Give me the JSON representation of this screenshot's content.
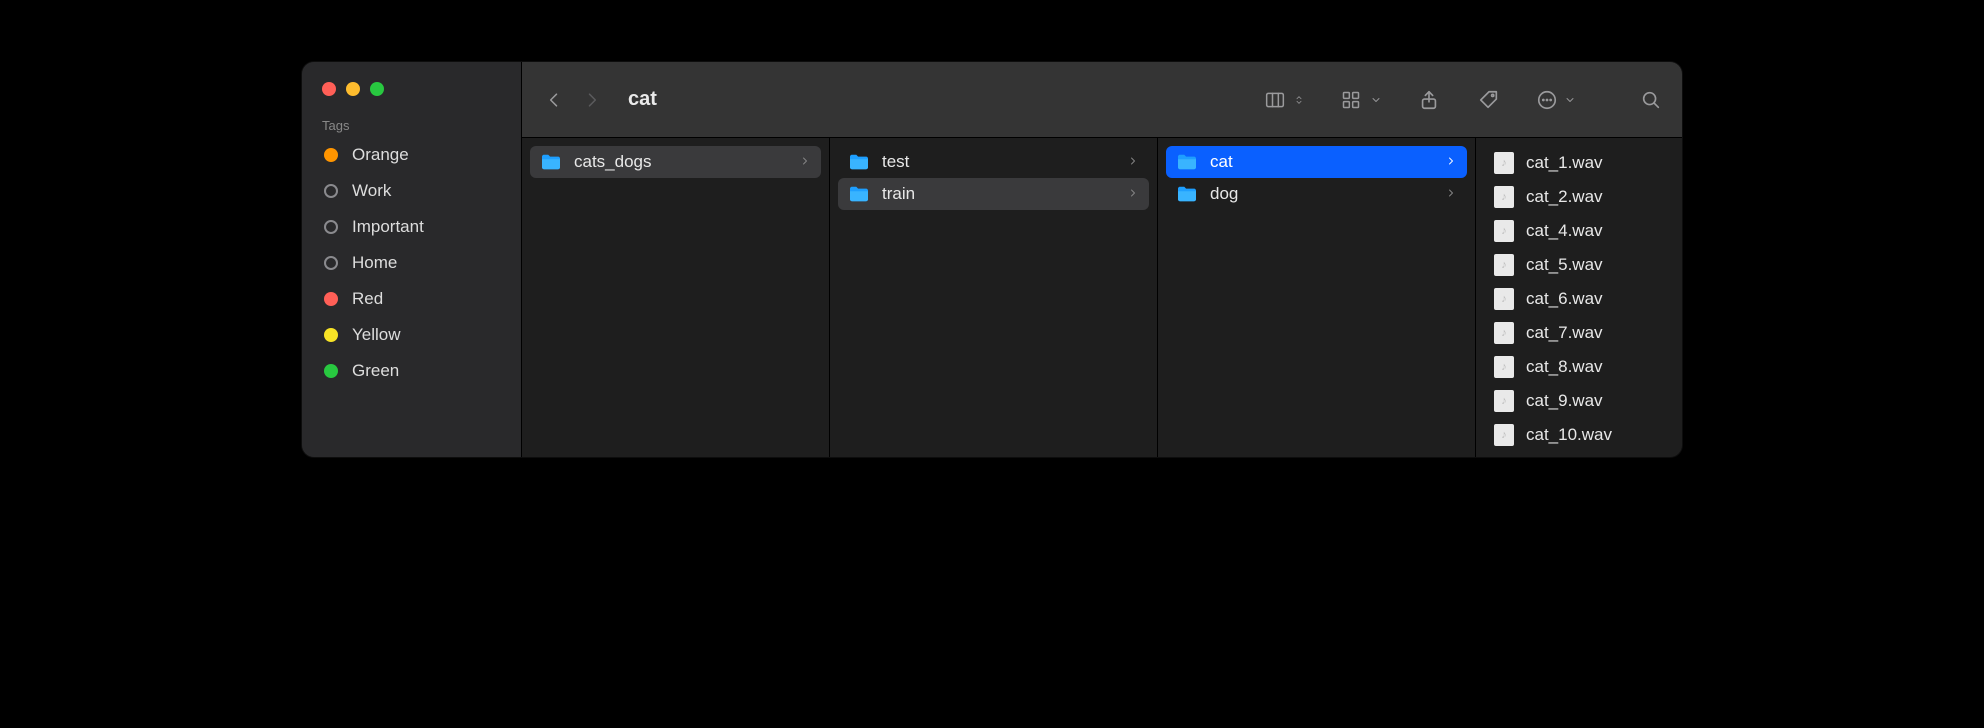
{
  "window": {
    "title": "cat"
  },
  "sidebar": {
    "section_label": "Tags",
    "tags": [
      {
        "label": "Orange",
        "color": "orange"
      },
      {
        "label": "Work",
        "color": "outline"
      },
      {
        "label": "Important",
        "color": "outline"
      },
      {
        "label": "Home",
        "color": "outline"
      },
      {
        "label": "Red",
        "color": "red"
      },
      {
        "label": "Yellow",
        "color": "yellow"
      },
      {
        "label": "Green",
        "color": "green"
      }
    ]
  },
  "columns": [
    {
      "items": [
        {
          "name": "cats_dogs",
          "type": "folder",
          "selected": "grey",
          "has_children": true
        }
      ]
    },
    {
      "items": [
        {
          "name": "test",
          "type": "folder",
          "selected": "none",
          "has_children": true
        },
        {
          "name": "train",
          "type": "folder",
          "selected": "grey",
          "has_children": true
        }
      ]
    },
    {
      "items": [
        {
          "name": "cat",
          "type": "folder",
          "selected": "blue",
          "has_children": true
        },
        {
          "name": "dog",
          "type": "folder",
          "selected": "none",
          "has_children": true
        }
      ]
    },
    {
      "items": [
        {
          "name": "cat_1.wav",
          "type": "audio"
        },
        {
          "name": "cat_2.wav",
          "type": "audio"
        },
        {
          "name": "cat_4.wav",
          "type": "audio"
        },
        {
          "name": "cat_5.wav",
          "type": "audio"
        },
        {
          "name": "cat_6.wav",
          "type": "audio"
        },
        {
          "name": "cat_7.wav",
          "type": "audio"
        },
        {
          "name": "cat_8.wav",
          "type": "audio"
        },
        {
          "name": "cat_9.wav",
          "type": "audio"
        },
        {
          "name": "cat_10.wav",
          "type": "audio"
        }
      ]
    }
  ]
}
